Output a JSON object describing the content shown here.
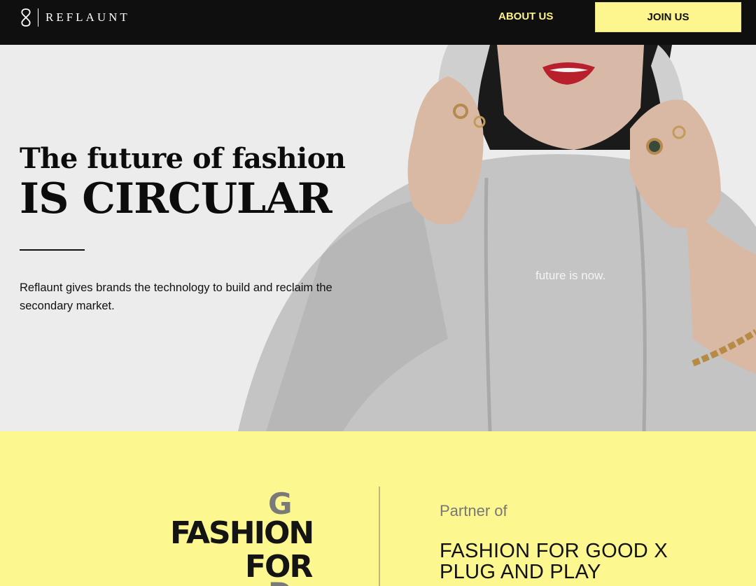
{
  "nav": {
    "brand": "REFLAUNT",
    "about_label": "ABOUT US",
    "join_label": "JOIN US"
  },
  "hero": {
    "title_line1": "The future of fashion",
    "title_line2": "IS CIRCULAR",
    "description": "Reflaunt gives brands the technology to build and reclaim the secondary market.",
    "shirt_print": "future is now."
  },
  "partner": {
    "logo_lines": [
      "FASHION",
      "FOR",
      "GOOD"
    ],
    "label": "Partner of",
    "name_line1": "FASHION FOR GOOD X",
    "name_line2": "PLUG AND PLAY"
  },
  "colors": {
    "nav_bg": "#0f0f0f",
    "accent_yellow": "#fdf78f",
    "about_text": "#fbf28c",
    "hero_bg": "#ececec"
  },
  "icons": [
    "reflaunt-logo-icon"
  ]
}
